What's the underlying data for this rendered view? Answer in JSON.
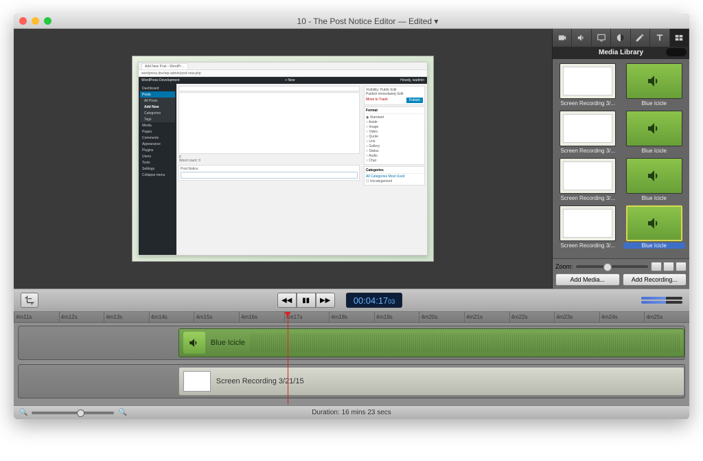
{
  "window": {
    "title": "10 - The Post Notice Editor — Edited",
    "title_suffix": "▾"
  },
  "preview": {
    "chrome_tab": "Add New Post ‹ WordPr…",
    "url": "wordpress.dev/wp-admin/post-new.php",
    "wp_bar_left": "WordPress Development",
    "wp_bar_new": "+ New",
    "wp_bar_right": "Howdy, wadmin",
    "sidebar": {
      "dashboard": "Dashboard",
      "posts": "Posts",
      "all_posts": "All Posts",
      "add_new": "Add New",
      "categories": "Categories",
      "tags": "Tags",
      "media": "Media",
      "pages": "Pages",
      "comments": "Comments",
      "appearance": "Appearance",
      "plugins": "Plugins",
      "users": "Users",
      "tools": "Tools",
      "settings": "Settings",
      "collapse": "Collapse menu"
    },
    "editor": {
      "word_count": "Word count: 0",
      "p": "p",
      "post_notice": "Post Notice"
    },
    "publish": {
      "visibility": "Visibility: Public Edit",
      "immediately": "Publish immediately Edit",
      "move_trash": "Move to Trash",
      "publish_btn": "Publish"
    },
    "format": {
      "hdr": "Format",
      "items": [
        "Standard",
        "Aside",
        "Image",
        "Video",
        "Quote",
        "Link",
        "Gallery",
        "Status",
        "Audio",
        "Chat"
      ]
    },
    "categories": {
      "hdr": "Categories",
      "tabs": "All Categories   Most Used",
      "uncat": "Uncategorized"
    }
  },
  "media": {
    "title": "Media Library",
    "items": [
      {
        "label": "Screen Recording 3/...",
        "kind": "screen"
      },
      {
        "label": "Blue Icicle",
        "kind": "audio"
      },
      {
        "label": "Screen Recording 3/...",
        "kind": "screen"
      },
      {
        "label": "Blue Icicle",
        "kind": "audio"
      },
      {
        "label": "Screen Recording 3/...",
        "kind": "screen"
      },
      {
        "label": "Blue Icicle",
        "kind": "audio"
      },
      {
        "label": "Screen Recording 3/...",
        "kind": "screen"
      },
      {
        "label": "Blue Icicle",
        "kind": "audio",
        "selected": true
      }
    ],
    "zoom_label": "Zoom:",
    "add_media": "Add Media...",
    "add_recording": "Add Recording..."
  },
  "transport": {
    "timecode_main": "00:04:17",
    "timecode_sub": "03"
  },
  "ruler": [
    "4m11s",
    "4m12s",
    "4m13s",
    "4m14s",
    "4m15s",
    "4m16s",
    "4m17s",
    "4m18s",
    "4m19s",
    "4m20s",
    "4m21s",
    "4m22s",
    "4m23s",
    "4m24s",
    "4m25s"
  ],
  "tracks": {
    "audio_clip": "Blue Icicle",
    "video_clip": "Screen Recording 3/21/15"
  },
  "footer": {
    "duration": "Duration: 16 mins 23 secs"
  }
}
